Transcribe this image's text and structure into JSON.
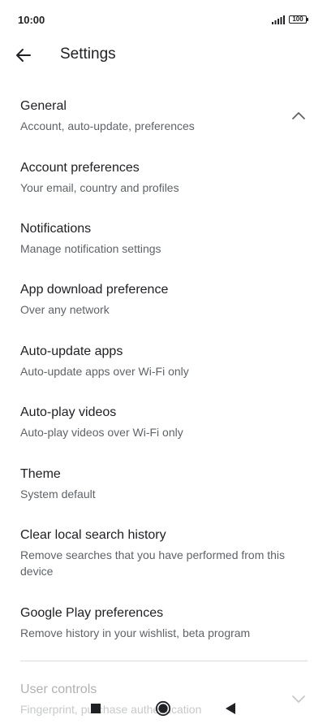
{
  "status_bar": {
    "time": "10:00",
    "battery": "100",
    "signal_icon": "signal-bars-icon"
  },
  "app_bar": {
    "title": "Settings",
    "back_icon": "arrow-back-icon"
  },
  "general": {
    "title": "General",
    "subtitle": "Account, auto-update, preferences",
    "expand_icon": "chevron-up-icon"
  },
  "items": [
    {
      "title": "Account preferences",
      "subtitle": "Your email, country and profiles"
    },
    {
      "title": "Notifications",
      "subtitle": "Manage notification settings"
    },
    {
      "title": "App download preference",
      "subtitle": "Over any network"
    },
    {
      "title": "Auto-update apps",
      "subtitle": "Auto-update apps over Wi-Fi only"
    },
    {
      "title": "Auto-play videos",
      "subtitle": "Auto-play videos over Wi-Fi only"
    },
    {
      "title": "Theme",
      "subtitle": "System default"
    },
    {
      "title": "Clear local search history",
      "subtitle": "Remove searches that you have performed from this device"
    },
    {
      "title": "Google Play preferences",
      "subtitle": "Remove history in your wishlist, beta program"
    }
  ],
  "user_controls": {
    "title": "User controls",
    "subtitle": "Fingerprint, purchase authentication",
    "expand_icon": "chevron-down-icon"
  },
  "nav_bar": {
    "recents_icon": "square-recents-icon",
    "home_icon": "circle-home-icon",
    "back_icon": "triangle-back-icon"
  }
}
